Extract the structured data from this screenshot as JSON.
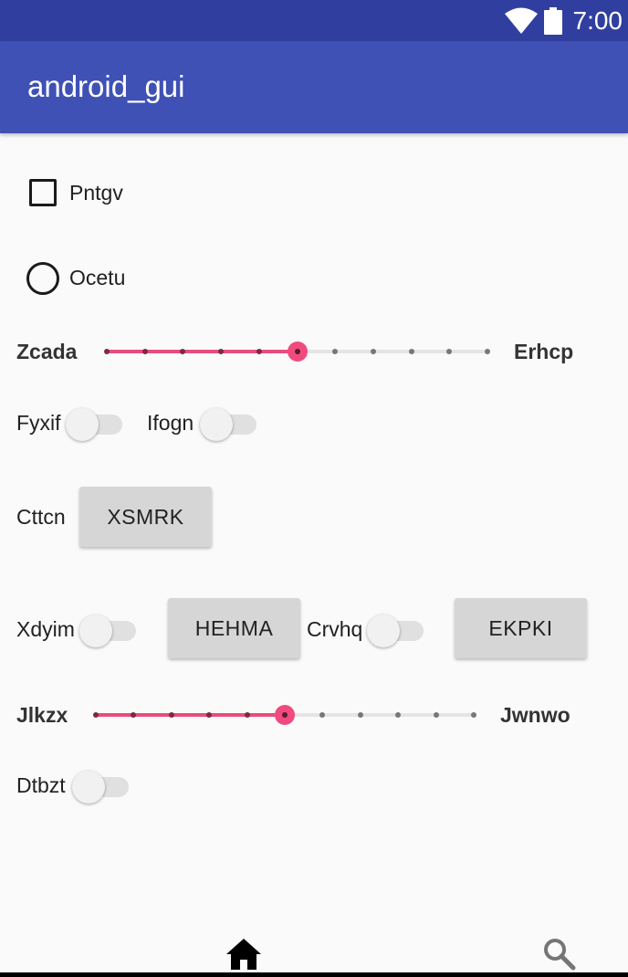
{
  "status_bar": {
    "time": "7:00",
    "icons": [
      "wifi-icon",
      "battery-icon"
    ]
  },
  "app_bar": {
    "title": "android_gui"
  },
  "checkbox": {
    "label": "Pntgv",
    "checked": false
  },
  "radio": {
    "label": "Ocetu",
    "selected": false
  },
  "slider1": {
    "label_left": "Zcada",
    "label_right": "Erhcp",
    "value": 5,
    "max": 10
  },
  "switches_row1": [
    {
      "label": "Fyxif",
      "on": false
    },
    {
      "label": "Ifogn",
      "on": false
    }
  ],
  "row_button1": {
    "label": "Cttcn",
    "button": "XSMRK"
  },
  "row_mixed": {
    "switch1_label": "Xdyim",
    "button1": "HEHMA",
    "switch2_label": "Crvhq",
    "button2": "EKPKI"
  },
  "slider2": {
    "label_left": "Jlkzx",
    "label_right": "Jwnwo",
    "value": 5,
    "max": 10
  },
  "switch_last": {
    "label": "Dtbzt",
    "on": false
  },
  "bottom_nav": {
    "items": [
      "home-icon",
      "search-icon"
    ]
  },
  "colors": {
    "primary": "#3f51b5",
    "primary_dark": "#303f9f",
    "accent": "#ff4081",
    "slider_active": "#e84d7c"
  }
}
